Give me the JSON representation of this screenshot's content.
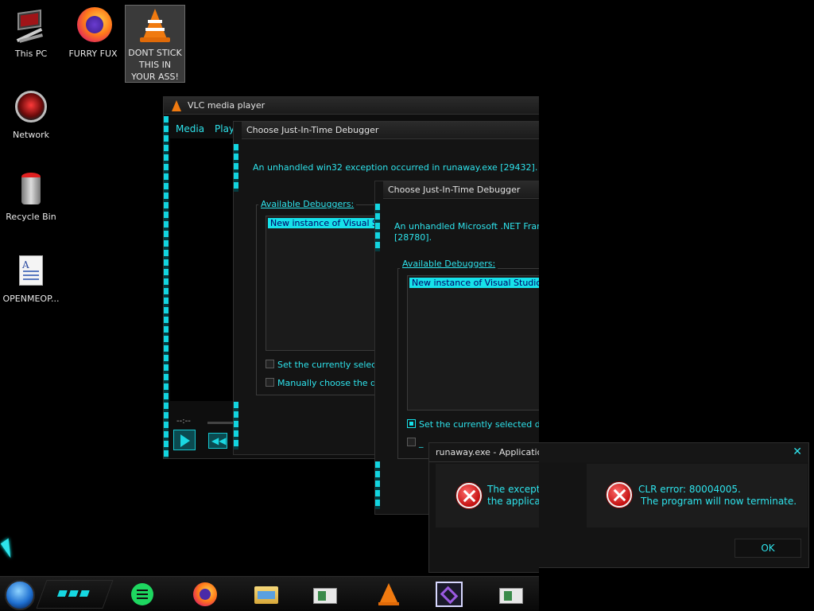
{
  "desktop": {
    "icons": [
      {
        "label": "This PC",
        "icon": "computer-icon"
      },
      {
        "label": "FURRY FUX",
        "icon": "firefox-icon"
      },
      {
        "label": "DONT STICK THIS IN YOUR ASS!",
        "icon": "vlc-cone-icon"
      },
      {
        "label": "Network",
        "icon": "network-icon"
      },
      {
        "label": "Recycle Bin",
        "icon": "recycle-bin-icon"
      },
      {
        "label": "OPENMEOP...",
        "icon": "document-icon"
      }
    ]
  },
  "vlc": {
    "title": "VLC media player",
    "menu": [
      "Media",
      "Play"
    ],
    "time": "--:--"
  },
  "jit1": {
    "title": "Choose Just-In-Time Debugger",
    "message": "An unhandled win32 exception occurred in runaway.exe [29432].",
    "available_label": "Available Debuggers:",
    "selected_item": "New instance of Visual Studio",
    "check1": "Set the currently selected",
    "check2": "Manually choose the debug"
  },
  "jit2": {
    "title": "Choose Just-In-Time Debugger",
    "message_line1": "An unhandled Microsoft .NET Framewo",
    "message_line2": "[28780].",
    "available_label": "Available Debuggers:",
    "selected_item": "New instance of Visual Studio Profe",
    "check1": "Set the currently selected debu",
    "check2": "_"
  },
  "apperror": {
    "title": "runaway.exe - Application Error",
    "msg_line1": "The exceptio",
    "msg_line2": "the applicati"
  },
  "clr": {
    "line1": "CLR error: 80004005.",
    "line2": "The program will now terminate.",
    "ok_label": "OK",
    "close_glyph": "✕"
  },
  "colors": {
    "accent": "#2ee3ec",
    "selection": "#16e2ea",
    "error": "#c31010"
  }
}
